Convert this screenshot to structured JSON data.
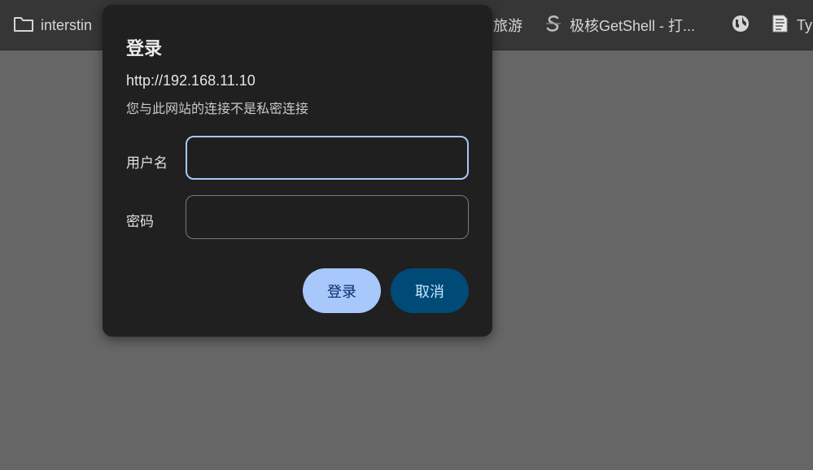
{
  "bookmarks": {
    "folder_label": "interstin",
    "travel_label": "旅游",
    "getshell_label": "极核GetShell - 打...",
    "ty_label": "Ty"
  },
  "dialog": {
    "title": "登录",
    "url": "http://192.168.11.10",
    "warning": "您与此网站的连接不是私密连接",
    "username_label": "用户名",
    "username_value": "",
    "password_label": "密码",
    "password_value": "",
    "login_button": "登录",
    "cancel_button": "取消"
  },
  "colors": {
    "page_background": "#666666",
    "bookmarks_bar": "#363636",
    "dialog_background": "#202020",
    "focus_ring": "#a8c7fa",
    "primary_button": "#a8c7fa",
    "secondary_button": "#004a77"
  },
  "icons": {
    "folder": "folder-icon",
    "getshell": "getshell-logo-icon",
    "globe": "globe-icon",
    "page": "page-favicon-icon"
  }
}
